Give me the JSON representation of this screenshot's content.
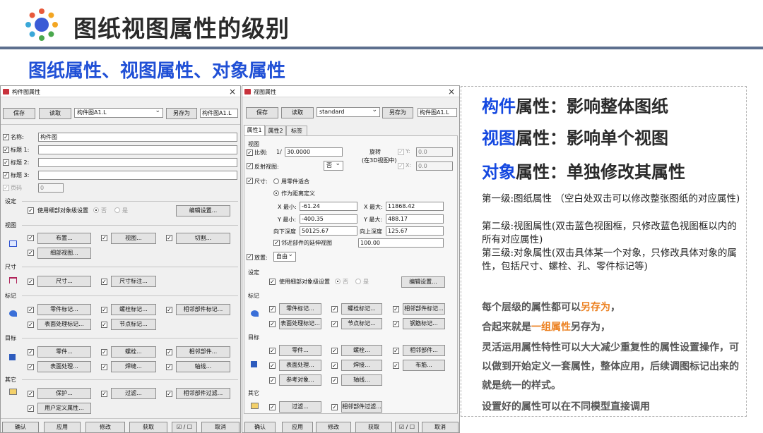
{
  "header": {
    "title": "图纸视图属性的级别",
    "subtitle": "图纸属性、视图属性、对象属性"
  },
  "win1": {
    "title": "构件图属性",
    "save": "保存",
    "read": "读取",
    "preset": "构件图A1.L",
    "saveas": "另存为",
    "saveas_value": "构件图A1.L",
    "name_label": "名称:",
    "name_value": "构件图",
    "t1": "标题 1:",
    "t2": "标题 2:",
    "t3": "标题 3:",
    "page_label": "页码",
    "page_value": "0",
    "settings": "设定",
    "use_detail": "使用细部对象级设置",
    "no": "否",
    "yes": "是",
    "edit_settings": "编辑设置...",
    "view_sec": "视图",
    "layout": "布置...",
    "view": "视图...",
    "cut": "切割...",
    "detail_view": "细部视图...",
    "dim_sec": "尺寸",
    "dim": "尺寸...",
    "dim_mark": "尺寸标注...",
    "mark_sec": "标记",
    "part_mark": "零件标记...",
    "bolt_mark": "螺栓标记...",
    "adj_mark": "相邻部件标记...",
    "surf_mark": "表面处理标记...",
    "node_mark": "节点标记...",
    "obj_sec": "目标",
    "part": "零件...",
    "bolt": "螺栓...",
    "adj_part": "相邻部件...",
    "surf": "表面处理...",
    "weld": "焊缝...",
    "axis": "轴线...",
    "other_sec": "其它",
    "protect": "保护...",
    "filter": "过滤...",
    "adj_filter": "相邻部件过滤...",
    "user_attr": "用户定义属性...",
    "ok": "确认",
    "apply": "应用",
    "modify": "修改",
    "get": "获取",
    "toggle": "☑ / ☐",
    "cancel": "取消"
  },
  "win2": {
    "title": "视图属性",
    "save": "保存",
    "read": "读取",
    "preset": "standard",
    "saveas": "另存为",
    "saveas_value": "构件图A1.L",
    "tab1": "属性1",
    "tab2": "属性2",
    "tab3": "标签",
    "view_sec": "视图",
    "scale_label": "比例:",
    "scale_prefix": "1/",
    "scale_value": "30.0000",
    "rotate": "旋转",
    "rotate_sub": "(在3D视图中)",
    "y_label": "Y:",
    "y_value": "0.0",
    "x_label": "X:",
    "x_value": "0.0",
    "mirror": "反射视图:",
    "mirror_value": "否",
    "size": "尺寸:",
    "fit_part": "用零件适合",
    "as_defined": "作为距离定义",
    "xmin_label": "X 最小:",
    "xmin": "-61.24",
    "xmax_label": "X 最大:",
    "xmax": "11868.42",
    "ymin_label": "Y 最小:",
    "ymin": "-400.35",
    "ymax_label": "Y 最大:",
    "ymax": "488.17",
    "depth_down_label": "向下深度",
    "depth_down": "50125.67",
    "depth_up_label": "向上深度",
    "depth_up": "125.67",
    "ext_label": "邻近部件的延伸视图",
    "ext_value": "100.00",
    "place_label": "放置:",
    "place_value": "自由",
    "settings": "设定",
    "use_detail": "使用细部对象级设置",
    "no": "否",
    "yes": "是",
    "edit_settings": "编辑设置...",
    "mark_sec": "标记",
    "part_mark": "零件标记...",
    "bolt_mark": "螺栓标记...",
    "adj_mark": "相邻部件标记...",
    "surf_mark": "表面处理标记...",
    "node_mark": "节点标记...",
    "rebar_mark": "钢筋标记...",
    "obj_sec": "目标",
    "part": "零件...",
    "bolt": "螺栓...",
    "adj_part": "相邻部件...",
    "surf": "表面处理...",
    "weld": "焊接...",
    "rebar": "布筋...",
    "ref": "参考对象...",
    "axis": "轴线...",
    "other_sec": "其它",
    "filter": "过滤...",
    "adj_filter": "相邻部件过滤...",
    "ok": "确认",
    "apply": "应用",
    "modify": "修改",
    "get": "获取",
    "toggle": "☑ / ☐",
    "cancel": "取消"
  },
  "right": {
    "h1_blue": "构件",
    "h1_rest": "属性：影响整体图纸",
    "h2_blue": "视图",
    "h2_rest": "属性：影响单个视图",
    "h3_blue": "对象",
    "h3_rest": "属性：单独修改其属性",
    "n1": "第一级:图纸属性 （空白处双击可以修改整张图纸的对应属性)",
    "n2": "第二级:视图属性(双击蓝色视图框，只修改蓝色视图框以内的所有对应属性)",
    "n3": "第三级:对象属性(双击具体某一个对象，只修改具体对象的属性，包括尺寸、螺栓、孔、零件标记等)",
    "t1_a": "每个层级的属性都可以",
    "t1_b": "另存为",
    "t1_c": "，",
    "t2_a": "合起来就是",
    "t2_b": "一组属性",
    "t2_c": "另存为，",
    "t3": "灵活运用属性特性可以大大减少重复性的属性设置操作，可以做到开始定义一套属性，整体应用，后续调图标记出来的就是统一的样式。",
    "t4": "设置好的属性可以在不同模型直接调用"
  },
  "colors": {
    "accent_blue": "#1448e0",
    "accent_orange": "#ec8121",
    "rule": "#5d6f8e"
  }
}
